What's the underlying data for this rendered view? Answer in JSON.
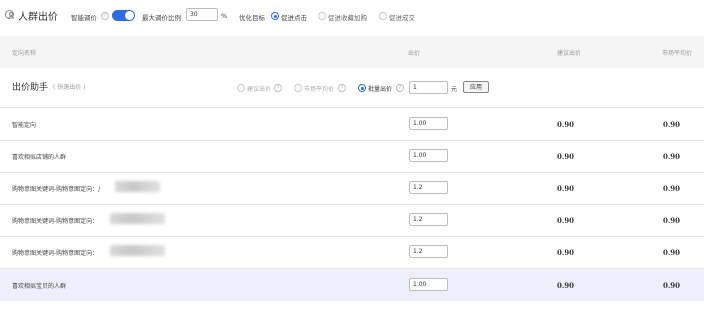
{
  "header": {
    "title": "人群出价",
    "smart_adjust_label": "智能调价",
    "max_ratio_label": "最大调价比例",
    "max_ratio_value": "30",
    "percent_unit": "%",
    "optimize_label": "优化目标",
    "goals": [
      {
        "label": "促进点击",
        "selected": true
      },
      {
        "label": "促进收藏加购",
        "selected": false
      },
      {
        "label": "促进成交",
        "selected": false
      }
    ],
    "smart_adjust_on": true
  },
  "columns": {
    "name": "定向名称",
    "bid": "出价",
    "suggested": "建议出价",
    "market": "市场平均价"
  },
  "assistant": {
    "title": "出价助手",
    "subtitle": "( 快速出价 )",
    "options": [
      {
        "label": "建议出价",
        "selected": false
      },
      {
        "label": "市场平均价",
        "selected": false
      },
      {
        "label": "批量出价",
        "selected": true
      }
    ],
    "batch_value": "1",
    "unit": "元",
    "apply_label": "应用"
  },
  "rows": [
    {
      "name": "智能定向",
      "bid": "1.00",
      "suggested": "0.90",
      "market": "0.90"
    },
    {
      "name": "喜欢相似店铺的人群",
      "bid": "1.00",
      "suggested": "0.90",
      "market": "0.90"
    },
    {
      "name": "购物意图关键词-购物意图定向：/",
      "bid": "1.2",
      "suggested": "0.90",
      "market": "0.90"
    },
    {
      "name": "购物意图关键词-购物意图定向：",
      "bid": "1.2",
      "suggested": "0.90",
      "market": "0.90"
    },
    {
      "name": "购物意图关键词-购物意图定向：",
      "bid": "1.2",
      "suggested": "0.90",
      "market": "0.90"
    },
    {
      "name": "喜欢相似宝贝的人群",
      "bid": "1.00",
      "suggested": "0.90",
      "market": "0.90"
    }
  ]
}
